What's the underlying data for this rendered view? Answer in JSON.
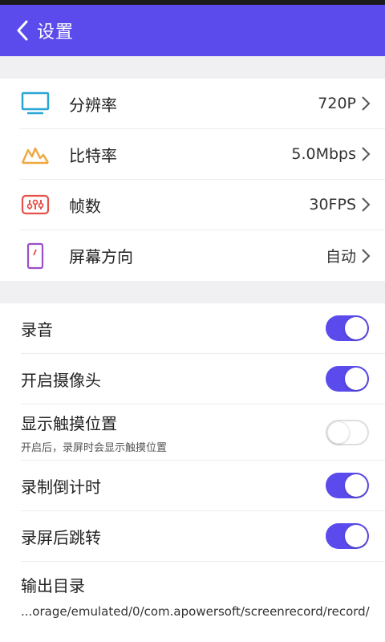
{
  "header": {
    "title": "设置",
    "back_icon": "chevron-left-icon"
  },
  "video_settings": [
    {
      "icon": "monitor-icon",
      "icon_color": "#2aa6d6",
      "label": "分辨率",
      "value": "720P"
    },
    {
      "icon": "mountain-icon",
      "icon_color": "#f0a840",
      "label": "比特率",
      "value": "5.0Mbps"
    },
    {
      "icon": "equalizer-icon",
      "icon_color": "#e8504a",
      "label": "帧数",
      "value": "30FPS"
    },
    {
      "icon": "phone-rotate-icon",
      "icon_color": "#9b4fc7",
      "label": "屏幕方向",
      "value": "自动"
    }
  ],
  "toggles": [
    {
      "label": "录音",
      "on": true
    },
    {
      "label": "开启摄像头",
      "on": true
    },
    {
      "label": "显示触摸位置",
      "sublabel": "开启后，录屏时会显示触摸位置",
      "on": false
    },
    {
      "label": "录制倒计时",
      "on": true
    },
    {
      "label": "录屏后跳转",
      "on": true
    }
  ],
  "output": {
    "label": "输出目录",
    "path": "...orage/emulated/0/com.apowersoft/screenrecord/record/"
  },
  "colors": {
    "accent": "#5b4bec",
    "background": "#f0f0f3"
  }
}
